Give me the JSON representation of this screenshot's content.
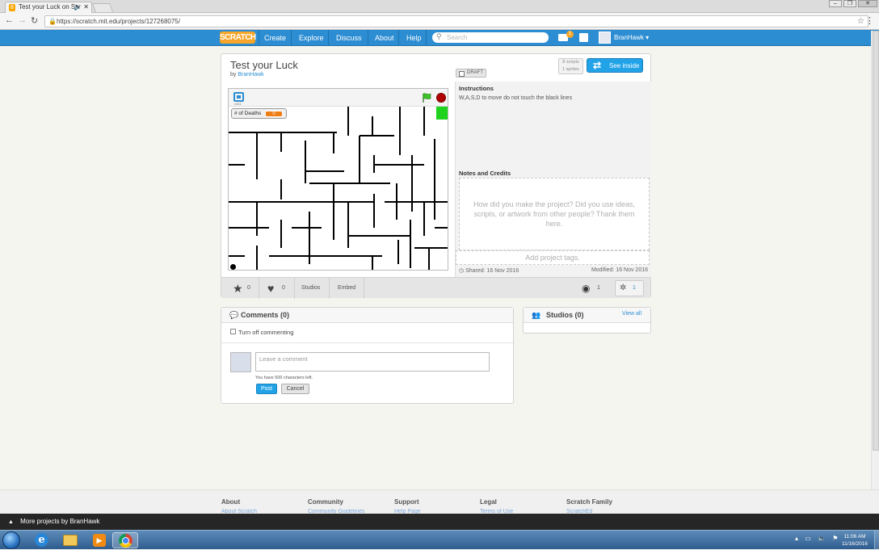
{
  "browser": {
    "tab_title": "Test your Luck on Scr",
    "tab_favicon": "8",
    "url": "https://scratch.mit.edu/projects/127268075/"
  },
  "nav": {
    "logo": "SCRATCH",
    "links": [
      "Create",
      "Explore",
      "Discuss",
      "About",
      "Help"
    ],
    "search_placeholder": "Search",
    "message_count": "1",
    "username": "BranHawk",
    "username_caret": "▾"
  },
  "project": {
    "title": "Test your Luck",
    "by_prefix": "by",
    "author": "BranHawk",
    "draft_label": "DRAFT",
    "scripts_count": "8 scripts",
    "sprites_count": "1 sprites",
    "see_inside": "See inside",
    "stage": {
      "version": "v451",
      "monitor_label": "# of Deaths",
      "monitor_value": "0"
    },
    "instructions_heading": "Instructions",
    "instructions_text": "W,A,S,D to move do not touch the black lines",
    "notes_heading": "Notes and Credits",
    "notes_placeholder": "How did you make the project? Did you use ideas, scripts, or artwork from other people? Thank them here.",
    "tags_placeholder": "Add project tags.",
    "shared": "Shared: 16 Nov 2016",
    "modified": "Modified: 16 Nov 2016",
    "stats": {
      "favorites": "0",
      "loves": "0",
      "studios_label": "Studios",
      "embed_label": "Embed",
      "views": "1",
      "remixes": "1"
    }
  },
  "comments": {
    "heading": "Comments (0)",
    "turn_off": "Turn off commenting",
    "placeholder": "Leave a comment",
    "remaining": "You have 500 characters left.",
    "post": "Post",
    "cancel": "Cancel"
  },
  "studios": {
    "heading": "Studios (0)",
    "view_all": "View all"
  },
  "footer": {
    "columns": [
      {
        "heading": "About",
        "first": "About Scratch"
      },
      {
        "heading": "Community",
        "first": "Community Guidelines"
      },
      {
        "heading": "Support",
        "first": "Help Page"
      },
      {
        "heading": "Legal",
        "first": "Terms of Use"
      },
      {
        "heading": "Scratch Family",
        "first": "ScratchEd"
      }
    ],
    "more_projects": "More projects by BranHawk"
  },
  "taskbar": {
    "time": "11:06 AM",
    "date": "11/16/2016"
  },
  "colors": {
    "scratch_blue": "#2c8dd2",
    "scratch_orange": "#f7a629",
    "goal_green": "#1ed21e",
    "stop_red": "#b20000"
  }
}
